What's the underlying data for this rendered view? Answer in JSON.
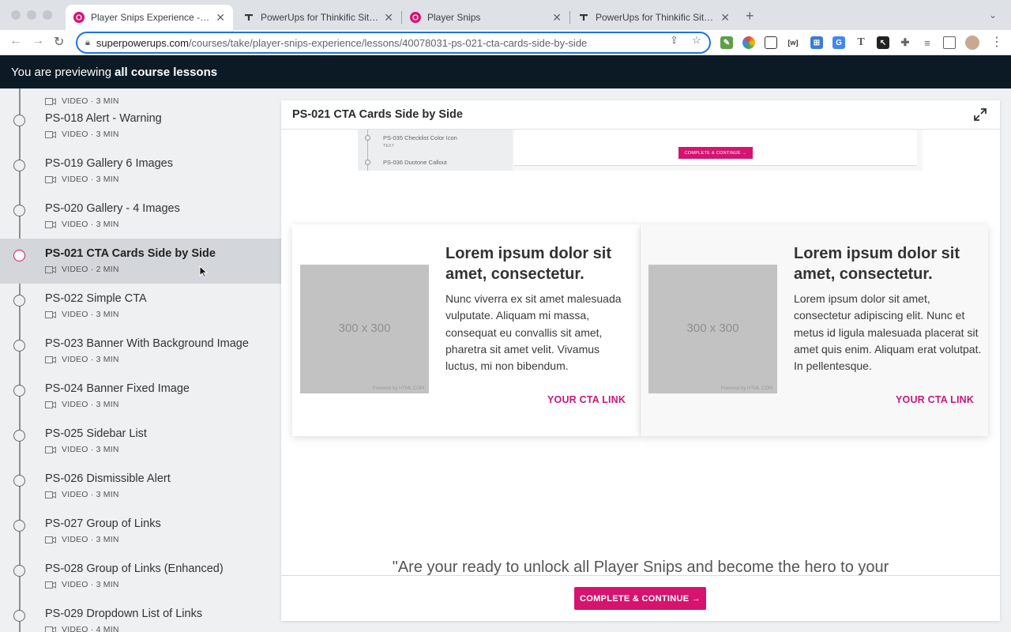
{
  "browser": {
    "tabs": [
      {
        "title": "Player Snips Experience - PowerUps",
        "active": true
      },
      {
        "title": "PowerUps for Thinkific Sites - PowerUps",
        "active": false
      },
      {
        "title": "Player Snips",
        "active": false
      },
      {
        "title": "PowerUps for Thinkific Sites - PowerUps",
        "active": false
      }
    ],
    "new_tab": "+",
    "url_host": "superpowerups.com",
    "url_path": "/courses/take/player-snips-experience/lessons/40078031-ps-021-cta-cards-side-by-side",
    "extensions": [
      {
        "icon": "pen-extension-icon",
        "color": "#5f9e4a",
        "glyph": "✎"
      },
      {
        "icon": "color-picker-extension-icon",
        "color": "#e8710a",
        "glyph": "●"
      },
      {
        "icon": "screenshot-extension-icon",
        "color": "#ffffff",
        "glyph": "⛶"
      },
      {
        "icon": "wappalyzer-extension-icon",
        "color": "#ffffff",
        "glyph": "[w]"
      },
      {
        "icon": "bitwarden-extension-icon",
        "color": "#3a7bd5",
        "glyph": "⊞"
      },
      {
        "icon": "translate-extension-icon",
        "color": "#4285f4",
        "glyph": "G"
      },
      {
        "icon": "font-extension-icon",
        "color": "#ffffff",
        "glyph": "T"
      },
      {
        "icon": "cursor-extension-icon",
        "color": "#222222",
        "glyph": "↖"
      },
      {
        "icon": "puzzle-extension-icon",
        "color": "#ffffff",
        "glyph": "✚"
      },
      {
        "icon": "reading-list-icon",
        "color": "#ffffff",
        "glyph": "≡"
      },
      {
        "icon": "side-panel-icon",
        "color": "#ffffff",
        "glyph": "▯"
      }
    ]
  },
  "preview_bar": {
    "prefix": "You are previewing",
    "emphasis": "all course lessons"
  },
  "sidebar": {
    "lessons": [
      {
        "title": "",
        "meta": "VIDEO · 3 MIN",
        "active": false
      },
      {
        "title": "PS-018 Alert - Warning",
        "meta": "VIDEO · 3 MIN",
        "active": false
      },
      {
        "title": "PS-019 Gallery 6 Images",
        "meta": "VIDEO · 3 MIN",
        "active": false
      },
      {
        "title": "PS-020 Gallery - 4 Images",
        "meta": "VIDEO · 3 MIN",
        "active": false
      },
      {
        "title": "PS-021 CTA Cards Side by Side",
        "meta": "VIDEO · 2 MIN",
        "active": true
      },
      {
        "title": "PS-022 Simple CTA",
        "meta": "VIDEO · 3 MIN",
        "active": false
      },
      {
        "title": "PS-023 Banner With Background Image",
        "meta": "VIDEO · 3 MIN",
        "active": false
      },
      {
        "title": "PS-024 Banner Fixed Image",
        "meta": "VIDEO · 3 MIN",
        "active": false
      },
      {
        "title": "PS-025 Sidebar List",
        "meta": "VIDEO · 3 MIN",
        "active": false
      },
      {
        "title": "PS-026 Dismissible Alert",
        "meta": "VIDEO · 3 MIN",
        "active": false
      },
      {
        "title": "PS-027 Group of Links",
        "meta": "VIDEO · 3 MIN",
        "active": false
      },
      {
        "title": "PS-028 Group of Links (Enhanced)",
        "meta": "VIDEO · 3 MIN",
        "active": false
      },
      {
        "title": "PS-029 Dropdown List of Links",
        "meta": "VIDEO · 4 MIN",
        "active": false
      }
    ]
  },
  "content": {
    "title": "PS-021 CTA Cards Side by Side",
    "mini_preview": {
      "items": [
        {
          "title": "PS-035 Checklist Color Icon",
          "sub": "TEXT"
        },
        {
          "title": "PS-036 Duotone Callout",
          "sub": ""
        }
      ],
      "button": "COMPLETE & CONTINUE →"
    },
    "cards": [
      {
        "image_label": "300 x 300",
        "image_credit": "Powered by HTML.COM",
        "heading": "Lorem ipsum dolor sit amet, consectetur.",
        "body": "Nunc viverra ex sit amet malesuada vulputate. Aliquam mi massa, consequat eu convallis sit amet, pharetra sit amet velit. Vivamus luctus, mi non bibendum.",
        "link": "YOUR CTA LINK"
      },
      {
        "image_label": "300 x 300",
        "image_credit": "Powered by HTML.COM",
        "heading": "Lorem ipsum dolor sit amet, consectetur.",
        "body": "Lorem ipsum dolor sit amet, consectetur adipiscing elit. Nunc et metus id ligula malesuada placerat sit amet quis enim. Aliquam erat volutpat. In pellentesque.",
        "link": "YOUR CTA LINK"
      }
    ],
    "quote_partial": "\"Are your ready to unlock all Player Snips and become the hero to your",
    "complete_button": "COMPLETE & CONTINUE →"
  },
  "colors": {
    "accent": "#d6136f",
    "link": "#c8197a",
    "preview_bar": "#0c1a26"
  }
}
